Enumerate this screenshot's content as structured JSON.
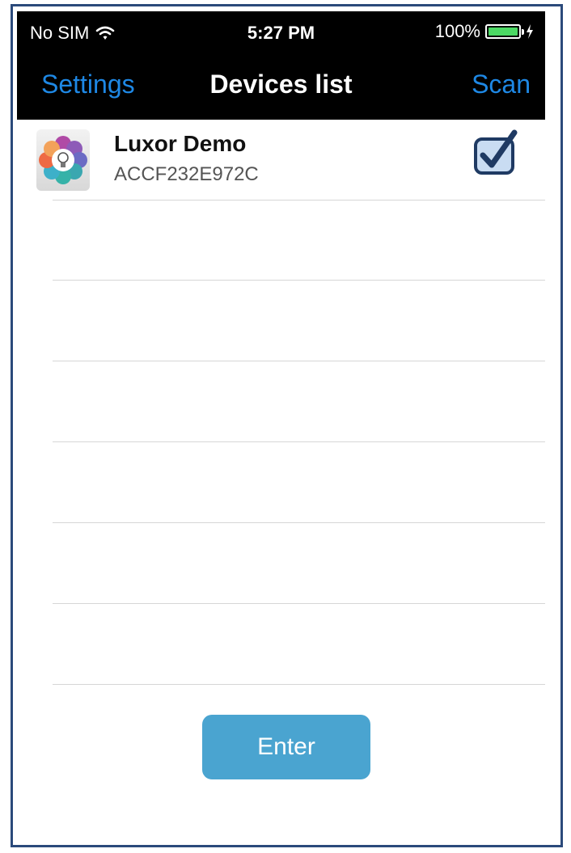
{
  "status_bar": {
    "carrier": "No SIM",
    "time": "5:27 PM",
    "battery_percent": "100%",
    "battery_level": 1.0
  },
  "nav": {
    "left_label": "Settings",
    "title": "Devices list",
    "right_label": "Scan"
  },
  "devices": [
    {
      "name": "Luxor Demo",
      "id": "ACCF232E972C",
      "selected": true,
      "icon": "bulb-flower-icon"
    }
  ],
  "empty_rows": 6,
  "enter_label": "Enter",
  "colors": {
    "nav_link": "#1e88e5",
    "button": "#4aa4d0",
    "battery": "#4cd964",
    "checkbox_border": "#1f3a63",
    "checkbox_fill": "#c9dcf2"
  }
}
